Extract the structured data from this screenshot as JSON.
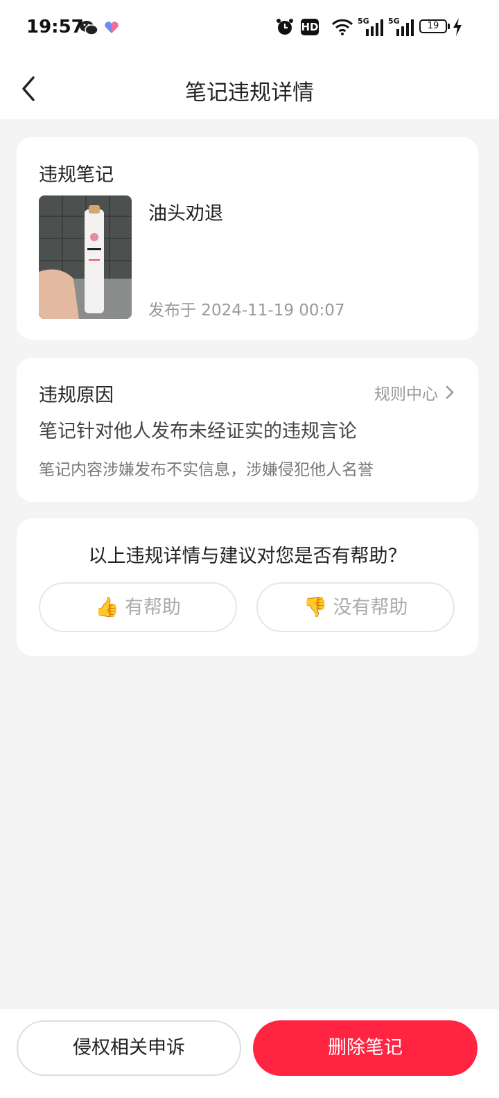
{
  "status_bar": {
    "time": "19:57",
    "battery": "19",
    "network_1": "5G",
    "network_2": "5G",
    "hd_label": "HD",
    "icons": [
      "wechat-icon",
      "heart-icon",
      "alarm-icon",
      "hd-icon",
      "wifi-icon",
      "signal-icon",
      "signal-icon",
      "battery-icon",
      "charging-icon"
    ]
  },
  "header": {
    "title": "笔记违规详情"
  },
  "note_card": {
    "section_title": "违规笔记",
    "note_title": "油头劝退",
    "published": "发布于 2024-11-19 00:07"
  },
  "reason_card": {
    "section_title": "违规原因",
    "rules_link": "规则中心",
    "reason": "笔记针对他人发布未经证实的违规言论",
    "detail": "笔记内容涉嫌发布不实信息，涉嫌侵犯他人名誉"
  },
  "feedback_card": {
    "question": "以上违规详情与建议对您是否有帮助？",
    "helpful_label": "有帮助",
    "not_helpful_label": "没有帮助"
  },
  "bottom_bar": {
    "appeal_label": "侵权相关申诉",
    "delete_label": "删除笔记"
  },
  "colors": {
    "accent": "#ff2442",
    "background": "#f4f4f4"
  }
}
